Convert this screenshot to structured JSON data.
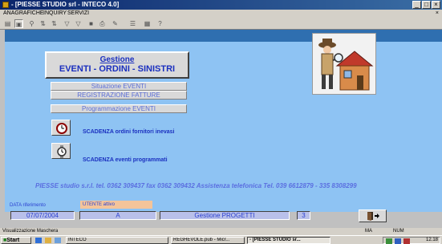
{
  "window": {
    "title": "- [PIESSE STUDIO srl - INTECO 4.0]",
    "controls": [
      "_",
      "□",
      "×"
    ]
  },
  "menu": {
    "items": [
      "ANAGRAFICHE",
      "INQUIRY",
      "SERVIZI"
    ],
    "right_close": "×"
  },
  "main": {
    "gestione_line1": "Gestione",
    "gestione_line2": "EVENTI - ORDINI - SINISTRI",
    "situazione_eventi": "Situazione EVENTI",
    "registrazione_fatture": "REGISTRAZIONE FATTURE",
    "programmazione_eventi": "Programmazione EVENTI",
    "scadenza_ordini": "SCADENZA ordini fornitori inevasi",
    "scadenza_eventi": "SCADENZA eventi programmati",
    "footer_contacts": "PIESSE studio s.r.l. tel. 0362 309437 fax 0362 309432   Assistenza telefonica Tel. 039 6612879 - 335 8308299"
  },
  "bottom": {
    "data_label": "DATA riferimento",
    "utente_value": "UTENTE attivo",
    "date_value": "07/07/2004",
    "field_a": "A",
    "gestione_progetti": "Gestione PROGETTI",
    "number_value": "3"
  },
  "statusbar": {
    "left": "Visualizzazione Maschera",
    "ma": "MA",
    "num": "NUM"
  },
  "taskbar": {
    "start": "Start",
    "tasks": [
      "INTECO",
      "REGHEVOLE.pub - Micr...",
      "- [PIESSE STUDIO sr..."
    ],
    "clock": "12.18"
  }
}
